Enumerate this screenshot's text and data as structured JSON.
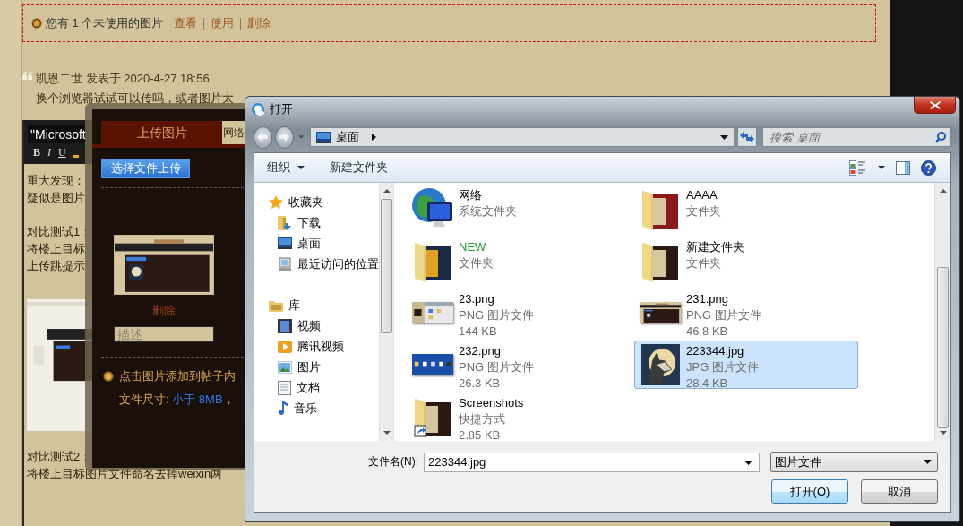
{
  "notice": {
    "message": "您有 1 个未使用的图片",
    "links": [
      "查看",
      "使用",
      "删除"
    ]
  },
  "post": {
    "byline": "凯恩二世 发表于 2020-4-27 18:56",
    "reply": "换个浏览器试试可以传吗，或者图片太"
  },
  "editor": {
    "font": "\"Microsoft",
    "format_buttons": [
      "B",
      "I",
      "U"
    ],
    "content": [
      {
        "kind": "text",
        "text": "重大发现："
      },
      {
        "kind": "text",
        "text": "疑似是图片"
      },
      {
        "kind": "blank"
      },
      {
        "kind": "text",
        "text": "对比测试1："
      },
      {
        "kind": "text",
        "text": "将楼上目标"
      },
      {
        "kind": "text",
        "text": "上传跳提示"
      },
      {
        "kind": "blank"
      },
      {
        "kind": "picture"
      },
      {
        "kind": "text",
        "text": "对比测试2："
      },
      {
        "kind": "text",
        "text": "将楼上目标图片文件命名去掉weixin两"
      }
    ]
  },
  "upload_dialog": {
    "tabs": [
      {
        "label": "上传图片",
        "selected": true
      },
      {
        "label": "网络",
        "selected": false
      }
    ],
    "select_button": "选择文件上传",
    "attachment": {
      "kind": "picture",
      "delete_link": "删除",
      "description_placeholder": "描述"
    },
    "tip": "点击图片添加到帖子内",
    "size_label": "文件尺寸:",
    "size_limit": "小于 8MB",
    "size_rest": "，"
  },
  "open_dialog": {
    "title": "打开",
    "address": "桌面",
    "search_placeholder": "搜索 桌面",
    "toolbar": [
      {
        "label": "组织",
        "has_menu": true
      },
      {
        "label": "新建文件夹",
        "has_menu": false
      }
    ],
    "nav": [
      {
        "label": "收藏夹",
        "children": [
          {
            "label": "下载"
          },
          {
            "label": "桌面"
          },
          {
            "label": "最近访问的位置"
          }
        ]
      },
      {
        "label": "库",
        "children": [
          {
            "label": "视频"
          },
          {
            "label": "腾讯视频"
          },
          {
            "label": "图片"
          },
          {
            "label": "文档"
          },
          {
            "label": "音乐"
          }
        ]
      }
    ],
    "files": [
      {
        "kind": "network",
        "name": "网络",
        "details": [
          "系统文件夹"
        ],
        "color": "#000000",
        "selected": false
      },
      {
        "kind": "folder",
        "name": "AAAA",
        "details": [
          "文件夹"
        ],
        "color": "#000000",
        "selected": false
      },
      {
        "kind": "folder",
        "name": "NEW",
        "details": [
          "文件夹"
        ],
        "color": "#1f9a2a",
        "selected": false
      },
      {
        "kind": "folder",
        "name": "新建文件夹",
        "details": [
          "文件夹"
        ],
        "color": "#000000",
        "selected": false
      },
      {
        "name": "23.png",
        "details": [
          "PNG 图片文件",
          "144 KB"
        ],
        "color": "#000000",
        "selected": false
      },
      {
        "name": "231.png",
        "details": [
          "PNG 图片文件",
          "46.8 KB"
        ],
        "color": "#000000",
        "selected": false
      },
      {
        "name": "232.png",
        "details": [
          "PNG 图片文件",
          "26.3 KB"
        ],
        "color": "#000000",
        "selected": false
      },
      {
        "name": "223344.jpg",
        "details": [
          "JPG 图片文件",
          "28.4 KB"
        ],
        "color": "#000000",
        "selected": true
      },
      {
        "kind": "shortcut",
        "name": "Screenshots",
        "details": [
          "快捷方式",
          "2.85 KB"
        ],
        "color": "#000000",
        "selected": false
      }
    ],
    "filename_label": "文件名(N):",
    "filename": "223344.jpg",
    "file_type": "图片文件",
    "buttons": [
      {
        "label": "打开(O)",
        "default": true
      },
      {
        "label": "取消",
        "default": false
      }
    ]
  }
}
